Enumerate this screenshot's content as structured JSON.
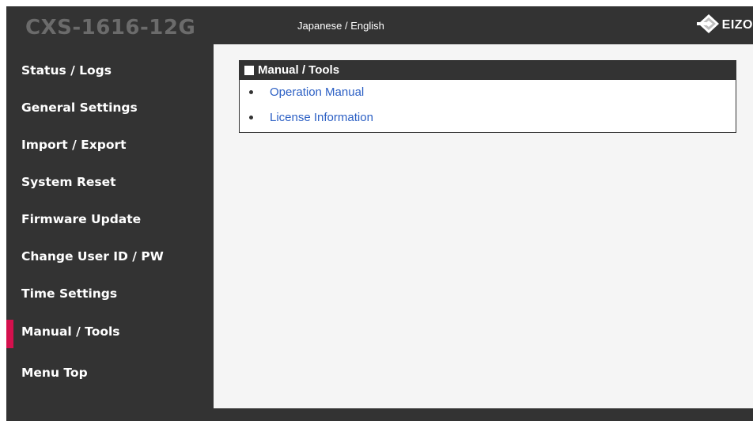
{
  "header": {
    "device_name": "CXS-1616-12G",
    "language_switch": "Japanese / English",
    "logo_text": "EIZO",
    "logo_icon": "eizo-diamond-icon"
  },
  "sidebar": {
    "items": [
      {
        "label": "Status / Logs",
        "active": false
      },
      {
        "label": "General Settings",
        "active": false
      },
      {
        "label": "Import / Export",
        "active": false
      },
      {
        "label": "System Reset",
        "active": false
      },
      {
        "label": "Firmware Update",
        "active": false
      },
      {
        "label": "Change User ID / PW",
        "active": false
      },
      {
        "label": "Time Settings",
        "active": false
      },
      {
        "label": "Manual / Tools",
        "active": true
      },
      {
        "label": "Menu Top",
        "active": false
      }
    ]
  },
  "main": {
    "panel_title": "Manual / Tools",
    "links": [
      {
        "label": "Operation Manual"
      },
      {
        "label": "License Information"
      }
    ]
  },
  "colors": {
    "background_dark": "#333333",
    "content_bg": "#f5f5f5",
    "active_indicator": "#d4104d",
    "link": "#2b5fc4"
  }
}
